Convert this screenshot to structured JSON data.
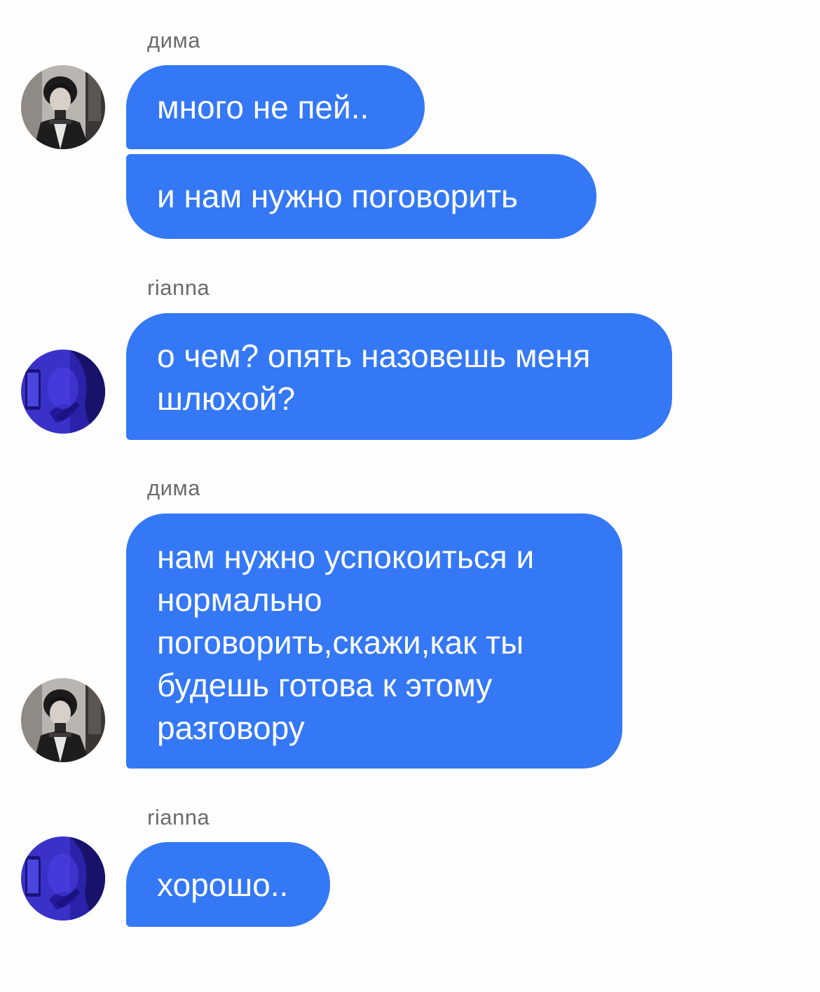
{
  "messages": [
    {
      "sender": "дима",
      "avatar": "dima-avatar",
      "bubbles": [
        "много не пей..",
        "и нам нужно поговорить"
      ]
    },
    {
      "sender": "rianna",
      "avatar": "rianna-avatar",
      "bubbles": [
        "о чем? опять назовешь меня\nшлюхой?"
      ]
    },
    {
      "sender": "дима",
      "avatar": "dima-avatar",
      "bubbles": [
        "нам нужно успокоиться и\nнормально\nпоговорить,скажи,как ты\nбудешь готова к этому\nразговору"
      ]
    },
    {
      "sender": "rianna",
      "avatar": "rianna-avatar",
      "bubbles": [
        "хорошо.."
      ]
    }
  ],
  "colors": {
    "bubble": "#3478f6",
    "bubble_text": "#ffffff",
    "sender_text": "#6b6b6b",
    "background": "#fefefe"
  }
}
